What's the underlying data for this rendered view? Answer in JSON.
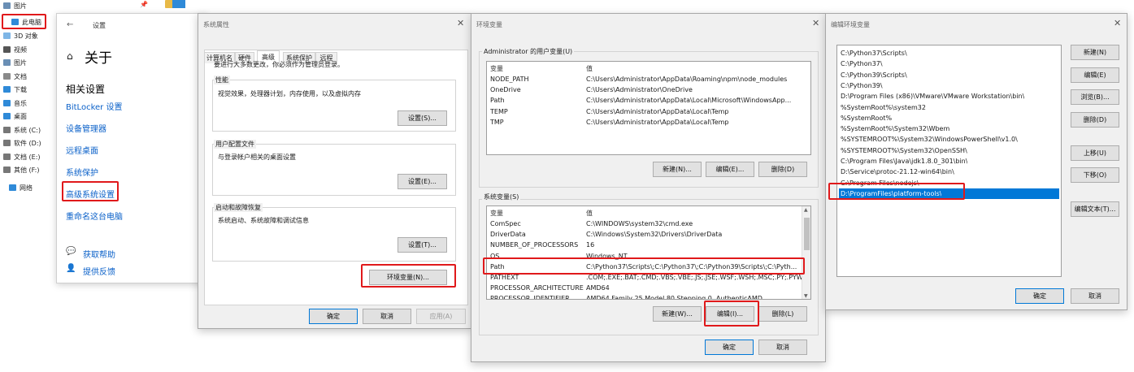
{
  "explorer": {
    "top_item": "图片",
    "items": [
      {
        "label": "此电脑",
        "icon": "computer-icon"
      },
      {
        "label": "3D 对象",
        "icon": "cube-icon"
      },
      {
        "label": "视频",
        "icon": "video-icon"
      },
      {
        "label": "图片",
        "icon": "picture-icon"
      },
      {
        "label": "文档",
        "icon": "document-icon"
      },
      {
        "label": "下载",
        "icon": "download-icon"
      },
      {
        "label": "音乐",
        "icon": "music-icon"
      },
      {
        "label": "桌面",
        "icon": "desktop-icon"
      },
      {
        "label": "系统 (C:)",
        "icon": "drive-icon"
      },
      {
        "label": "软件 (D:)",
        "icon": "drive-icon"
      },
      {
        "label": "文档 (E:)",
        "icon": "drive-icon"
      },
      {
        "label": "其他 (F:)",
        "icon": "drive-icon"
      },
      {
        "label": "网络",
        "icon": "network-icon"
      }
    ]
  },
  "settings": {
    "title": "设置",
    "header": "关于",
    "section": "相关设置",
    "links": [
      "BitLocker 设置",
      "设备管理器",
      "远程桌面",
      "系统保护",
      "高级系统设置",
      "重命名这台电脑"
    ],
    "help": "获取帮助",
    "feedback": "提供反馈"
  },
  "sysprops": {
    "title": "系统属性",
    "tabs": [
      "计算机名",
      "硬件",
      "高级",
      "系统保护",
      "远程"
    ],
    "note": "要进行大多数更改，你必须作为管理员登录。",
    "perf_label": "性能",
    "perf_desc": "视觉效果，处理器计划，内存使用，以及虚拟内存",
    "profile_label": "用户配置文件",
    "profile_desc": "与登录帐户相关的桌面设置",
    "startup_label": "启动和故障恢复",
    "startup_desc": "系统启动、系统故障和调试信息",
    "settings_btn": "设置(S)...",
    "settings_btn2": "设置(E)...",
    "settings_btn3": "设置(T)...",
    "env_btn": "环境变量(N)...",
    "ok": "确定",
    "cancel": "取消",
    "apply": "应用(A)"
  },
  "envvars": {
    "title": "环境变量",
    "user_label": "Administrator 的用户变量(U)",
    "col_var": "变量",
    "col_val": "值",
    "user_rows": [
      {
        "name": "NODE_PATH",
        "value": "C:\\Users\\Administrator\\AppData\\Roaming\\npm\\node_modules"
      },
      {
        "name": "OneDrive",
        "value": "C:\\Users\\Administrator\\OneDrive"
      },
      {
        "name": "Path",
        "value": "C:\\Users\\Administrator\\AppData\\Local\\Microsoft\\WindowsApp..."
      },
      {
        "name": "TEMP",
        "value": "C:\\Users\\Administrator\\AppData\\Local\\Temp"
      },
      {
        "name": "TMP",
        "value": "C:\\Users\\Administrator\\AppData\\Local\\Temp"
      }
    ],
    "user_new": "新建(N)...",
    "user_edit": "编辑(E)...",
    "user_delete": "删除(D)",
    "sys_label": "系统变量(S)",
    "sys_rows": [
      {
        "name": "ComSpec",
        "value": "C:\\WINDOWS\\system32\\cmd.exe"
      },
      {
        "name": "DriverData",
        "value": "C:\\Windows\\System32\\Drivers\\DriverData"
      },
      {
        "name": "NUMBER_OF_PROCESSORS",
        "value": "16"
      },
      {
        "name": "OS",
        "value": "Windows_NT"
      },
      {
        "name": "Path",
        "value": "C:\\Python37\\Scripts\\;C:\\Python37\\;C:\\Python39\\Scripts\\;C:\\Pyth..."
      },
      {
        "name": "PATHEXT",
        "value": ".COM;.EXE;.BAT;.CMD;.VBS;.VBE;.JS;.JSE;.WSF;.WSH;.MSC;.PY;.PYW"
      },
      {
        "name": "PROCESSOR_ARCHITECTURE",
        "value": "AMD64"
      },
      {
        "name": "PROCESSOR_IDENTIFIER",
        "value": "AMD64 Family 25 Model 80 Stepping 0, AuthenticAMD"
      }
    ],
    "sys_new": "新建(W)...",
    "sys_edit": "编辑(I)...",
    "sys_delete": "删除(L)",
    "ok": "确定",
    "cancel": "取消"
  },
  "editenv": {
    "title": "编辑环境变量",
    "entries": [
      "C:\\Python37\\Scripts\\",
      "C:\\Python37\\",
      "C:\\Python39\\Scripts\\",
      "C:\\Python39\\",
      "D:\\Program Files (x86)\\VMware\\VMware Workstation\\bin\\",
      "%SystemRoot%\\system32",
      "%SystemRoot%",
      "%SystemRoot%\\System32\\Wbem",
      "%SYSTEMROOT%\\System32\\WindowsPowerShell\\v1.0\\",
      "%SYSTEMROOT%\\System32\\OpenSSH\\",
      "C:\\Program Files\\Java\\jdk1.8.0_301\\bin\\",
      "D:\\Service\\protoc-21.12-win64\\bin\\",
      "C:\\Program Files\\nodejs\\",
      "D:\\ProgramFiles\\platform-tools\\"
    ],
    "new": "新建(N)",
    "edit": "编辑(E)",
    "browse": "浏览(B)...",
    "delete": "删除(D)",
    "up": "上移(U)",
    "down": "下移(O)",
    "edit_text": "编辑文本(T)...",
    "ok": "确定",
    "cancel": "取消"
  },
  "colors": {
    "highlight": "#e0191b",
    "selection": "#0078d7",
    "link": "#0b61c9"
  }
}
